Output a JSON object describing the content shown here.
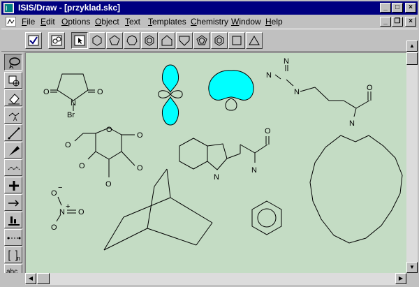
{
  "window": {
    "title": "ISIS/Draw - [przyklad.skc]"
  },
  "menu": {
    "items": [
      {
        "label": "File",
        "u": "F",
        "rest": "ile"
      },
      {
        "label": "Edit",
        "u": "E",
        "rest": "dit"
      },
      {
        "label": "Options",
        "u": "O",
        "rest": "ptions"
      },
      {
        "label": "Object",
        "u": "O",
        "rest": "bject"
      },
      {
        "label": "Text",
        "u": "T",
        "rest": "ext"
      },
      {
        "label": "Templates",
        "u": "T",
        "rest": "emplates"
      },
      {
        "label": "Chemistry",
        "u": "C",
        "rest": "hemistry"
      },
      {
        "label": "Window",
        "u": "W",
        "rest": "indow"
      },
      {
        "label": "Help",
        "u": "H",
        "rest": "elp"
      }
    ]
  },
  "left_toolbar": {
    "text_tool": "abc",
    "bracket_sub": "n"
  },
  "molecules": {
    "nbs": {
      "o1": "O",
      "o2": "O",
      "n": "N",
      "br": "Br"
    },
    "sugar": {
      "o_ring": "O",
      "o_ch2": "O",
      "o1": "O",
      "o2": "O",
      "o3": "O",
      "o4": "O"
    },
    "arginine": {
      "nh": "N",
      "n2": "N",
      "n3": "N",
      "o": "O",
      "n_alpha": "N"
    },
    "tryptophan": {
      "o": "O",
      "n_indole": "N",
      "n_alpha": "N"
    },
    "nitro": {
      "o_top": "O",
      "o_top_charge": "−",
      "n": "N",
      "n_charge": "+",
      "o_right": "O",
      "o_bottom": "O"
    }
  },
  "colors": {
    "canvas_bg": "#c4dcc4",
    "orbital_fill": "#00ffff",
    "title_bar": "#000080"
  }
}
